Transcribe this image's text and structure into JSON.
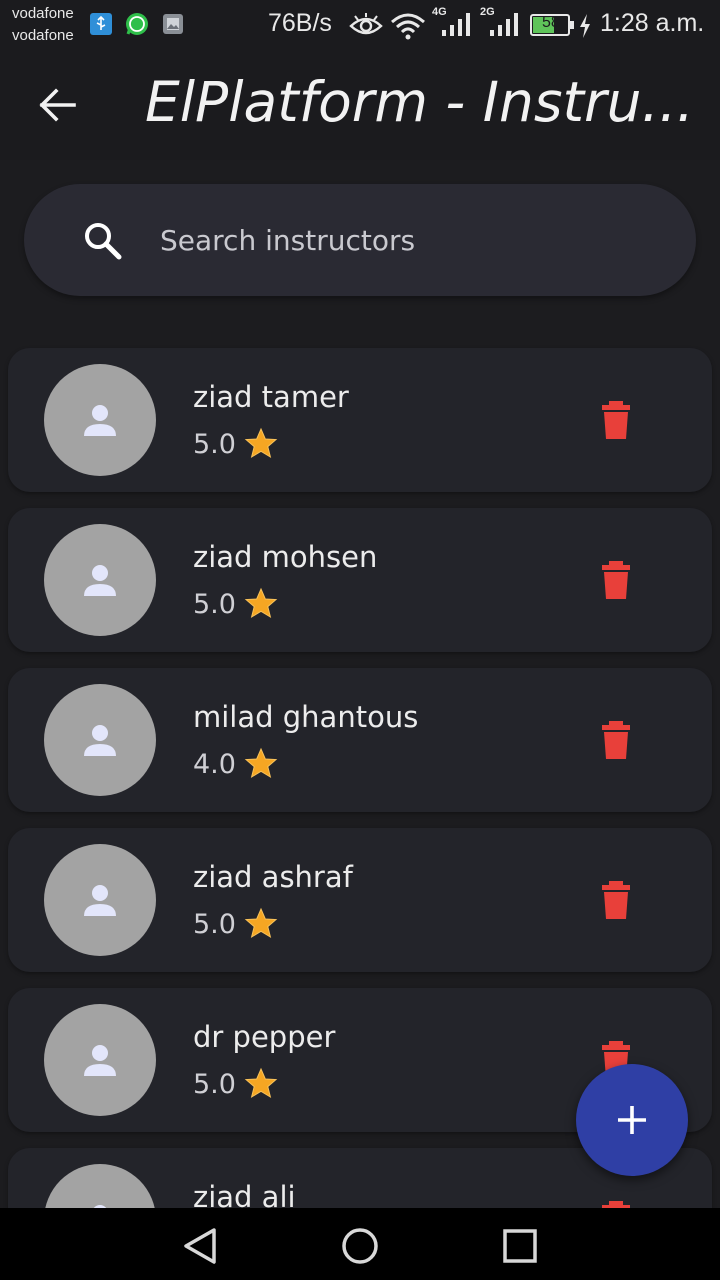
{
  "status_bar": {
    "carrier_1": "vodafone",
    "carrier_2": "vodafone",
    "net_speed": "76B/s",
    "network_1": "4G",
    "network_2": "2G",
    "battery": "58",
    "time": "1:28 a.m."
  },
  "app_bar": {
    "title": "ElPlatform - Instru..."
  },
  "search": {
    "placeholder": "Search instructors",
    "value": ""
  },
  "instructors": [
    {
      "name": "ziad tamer",
      "rating": "5.0"
    },
    {
      "name": "ziad mohsen",
      "rating": "5.0"
    },
    {
      "name": "milad ghantous",
      "rating": "4.0"
    },
    {
      "name": "ziad ashraf",
      "rating": "5.0"
    },
    {
      "name": "dr pepper",
      "rating": "5.0"
    },
    {
      "name": "ziad ali",
      "rating": ""
    }
  ],
  "colors": {
    "background": "#1c1c1f",
    "card": "#23242a",
    "delete": "#e8403a",
    "star": "#f5a623",
    "fab": "#2f3fa5",
    "avatar": "#a3a3a3"
  },
  "icons": {
    "back": "arrow-back-icon",
    "search": "search-icon",
    "avatar": "person-icon",
    "star": "star-icon",
    "delete": "trash-icon",
    "fab": "plus-icon",
    "nav_back": "triangle-back-icon",
    "nav_home": "circle-home-icon",
    "nav_recents": "square-recents-icon"
  }
}
